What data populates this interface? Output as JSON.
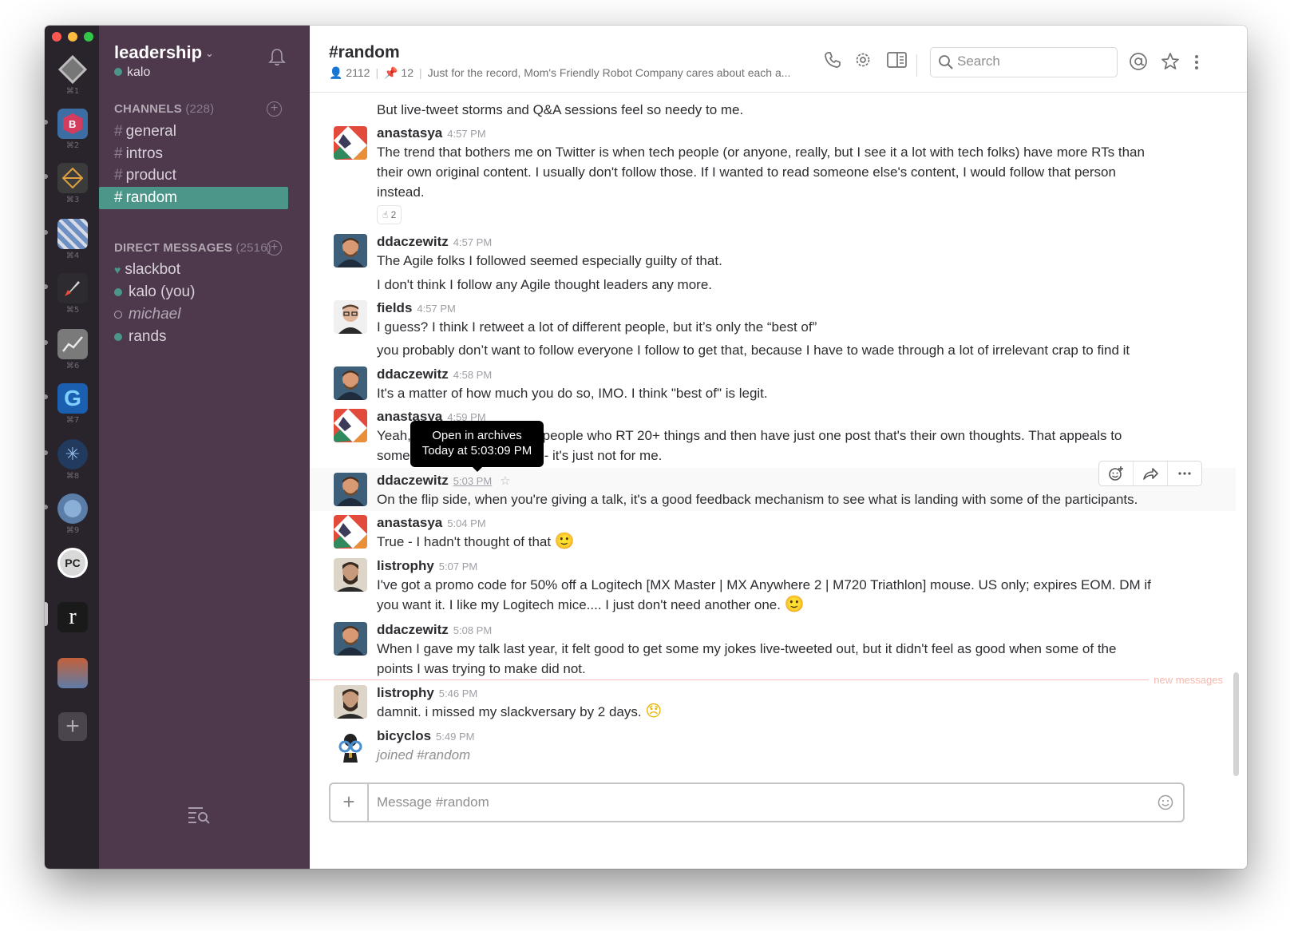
{
  "teams": {
    "items": [
      {
        "shortcut": "⌘1"
      },
      {
        "shortcut": "⌘2"
      },
      {
        "shortcut": "⌘3"
      },
      {
        "shortcut": "⌘4"
      },
      {
        "shortcut": "⌘5"
      },
      {
        "shortcut": "⌘6"
      },
      {
        "shortcut": "⌘7"
      },
      {
        "shortcut": "⌘8"
      },
      {
        "shortcut": "⌘9"
      },
      {
        "label": "PC"
      },
      {
        "label": "r"
      },
      {
        "shortcut": ""
      }
    ],
    "add_label": "+"
  },
  "sidebar": {
    "team_name": "leadership",
    "user": "kalo",
    "channels_title": "CHANNELS",
    "channels_count": "(228)",
    "channels": [
      {
        "name": "general"
      },
      {
        "name": "intros"
      },
      {
        "name": "product"
      },
      {
        "name": "random"
      }
    ],
    "dms_title": "DIRECT MESSAGES",
    "dms_count": "(2516)",
    "dms": [
      {
        "name": "slackbot"
      },
      {
        "name": "kalo (you)"
      },
      {
        "name": "michael"
      },
      {
        "name": "rands"
      }
    ]
  },
  "header": {
    "channel": "#random",
    "members": "2112",
    "pins": "12",
    "topic": "Just for the record, Mom's Friendly Robot Company cares about each a...",
    "search_placeholder": "Search"
  },
  "messages": {
    "m0": {
      "text": "But live-tweet storms and Q&A sessions feel so needy to me."
    },
    "m1": {
      "author": "anastasya",
      "time": "4:57 PM",
      "l1": "The trend that bothers me on Twitter is when tech people (or anyone, really, but I see it a lot with tech folks) have more RTs than",
      "l2": "their own original content. I usually don't follow those. If I wanted to read someone else's content, I would follow that person",
      "l3": "instead.",
      "reaction": "☝ 2"
    },
    "m2": {
      "author": "ddaczewitz",
      "time": "4:57 PM",
      "l1": "The Agile folks I followed seemed especially guilty of that.",
      "l2": "I don't think I follow any Agile thought leaders any more."
    },
    "m3": {
      "author": "fields",
      "time": "4:57 PM",
      "l1": "I guess? I think I retweet a lot of different people, but it’s only the “best of”",
      "l2": "you probably don’t want to follow everyone I follow to get that, because I have to wade through a lot of irrelevant crap to find it"
    },
    "m4": {
      "author": "ddaczewitz",
      "time": "4:58 PM",
      "l1": "It's a matter of how much you do so, IMO.  I think \"best of\" is legit."
    },
    "m5": {
      "author": "anastasya",
      "time": "4:59 PM",
      "l1a": "Yeah,",
      "l1b": "people who RT 20+ things and then have just one post that's their own thoughts. That appeals to",
      "l2a": "some",
      "l2b": "- it's just not for me."
    },
    "m6": {
      "author": "ddaczewitz",
      "time": "5:03 PM",
      "l1": "On the flip side, when you're giving a talk, it's  a good feedback mechanism to see what is landing with some of the participants."
    },
    "m7": {
      "author": "anastasya",
      "time": "5:04 PM",
      "l1": "True - I hadn't thought of that"
    },
    "m8": {
      "author": "listrophy",
      "time": "5:07 PM",
      "l1": "I've got a promo code for 50% off a Logitech [MX Master | MX Anywhere 2 | M720 Triathlon] mouse. US only; expires EOM. DM if",
      "l2": "you want it. I like my Logitech mice.... I just don't need another one."
    },
    "m9": {
      "author": "ddaczewitz",
      "time": "5:08 PM",
      "l1": "When I gave my talk last year, it felt good to get some my jokes live-tweeted out, but it didn't feel as good when some of the",
      "l2": "points I was trying to make did not."
    },
    "m10": {
      "author": "listrophy",
      "time": "5:46 PM",
      "l1": "damnit. i missed my slackversary by 2 days."
    },
    "m11": {
      "author": "bicyclos",
      "time": "5:49 PM",
      "l1": "joined #random"
    }
  },
  "tooltip": {
    "line1": "Open in archives",
    "line2": "Today at 5:03:09 PM"
  },
  "new_messages_label": "new messages",
  "composer": {
    "placeholder": "Message #random",
    "add_label": "+"
  },
  "colors": {
    "sidebar": "#4d394b",
    "active_channel": "#4c9689",
    "teams_rail": "#29232b",
    "presence": "#4c9689"
  }
}
